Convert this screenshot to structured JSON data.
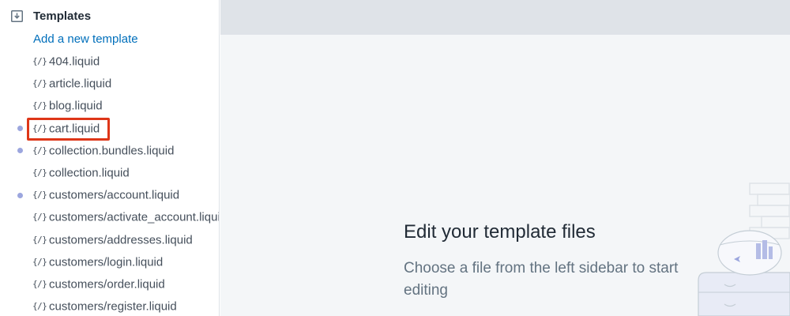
{
  "sidebar": {
    "section_title": "Templates",
    "section_icon": "folder-download-icon",
    "add_link": "Add a new template",
    "file_icon": "{/}",
    "files": [
      {
        "name": "404.liquid",
        "modified": false
      },
      {
        "name": "article.liquid",
        "modified": false
      },
      {
        "name": "blog.liquid",
        "modified": false
      },
      {
        "name": "cart.liquid",
        "modified": true,
        "highlighted": true
      },
      {
        "name": "collection.bundles.liquid",
        "modified": true
      },
      {
        "name": "collection.liquid",
        "modified": false
      },
      {
        "name": "customers/account.liquid",
        "modified": true
      },
      {
        "name": "customers/activate_account.liquid",
        "modified": false
      },
      {
        "name": "customers/addresses.liquid",
        "modified": false
      },
      {
        "name": "customers/login.liquid",
        "modified": false
      },
      {
        "name": "customers/order.liquid",
        "modified": false
      },
      {
        "name": "customers/register.liquid",
        "modified": false
      }
    ]
  },
  "main": {
    "empty_title": "Edit your template files",
    "empty_description": "Choose a file from the left sidebar to start editing"
  },
  "colors": {
    "link": "#006fbb",
    "modified_dot": "#9ca6de",
    "highlight": "#de3618",
    "topbar": "#dfe3e8",
    "canvas": "#f4f6f8"
  }
}
